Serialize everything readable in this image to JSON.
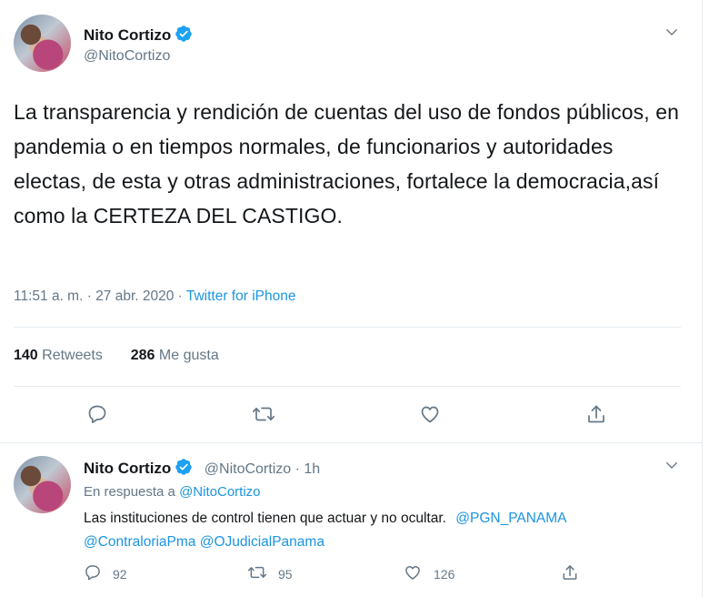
{
  "main_tweet": {
    "author_name": "Nito Cortizo",
    "author_handle": "@NitoCortizo",
    "text": "La transparencia y rendición de cuentas del uso de fondos públicos, en pandemia o en tiempos normales, de funcionarios y autoridades electas, de esta y otras administraciones, fortalece la democracia,así como la CERTEZA DEL CASTIGO.",
    "time": "11:51 a. m. · 27 abr. 2020 · ",
    "source": "Twitter for iPhone",
    "retweets_count": "140",
    "retweets_label": " Retweets",
    "likes_count": "286",
    "likes_label": " Me gusta"
  },
  "reply_tweet": {
    "author_name": "Nito Cortizo",
    "author_handle": "@NitoCortizo",
    "age": " · 1h",
    "reply_to_label": "En respuesta a ",
    "reply_to_handle": "@NitoCortizo",
    "text": "Las instituciones de control tienen que actuar y no ocultar. ",
    "mention1": "@PGN_PANAMA",
    "mention2": "@ContraloriaPma",
    "mention3": "@OJudicialPanama",
    "replies": "92",
    "retweets": "95",
    "likes": "126"
  },
  "colors": {
    "accent": "#1da1f2",
    "link": "#1b95e0",
    "muted": "#657786",
    "text": "#14171a",
    "border": "#e6ecf0"
  },
  "icons": [
    "verified-badge-icon",
    "chevron-down-icon",
    "reply-icon",
    "retweet-icon",
    "like-icon",
    "share-icon"
  ]
}
